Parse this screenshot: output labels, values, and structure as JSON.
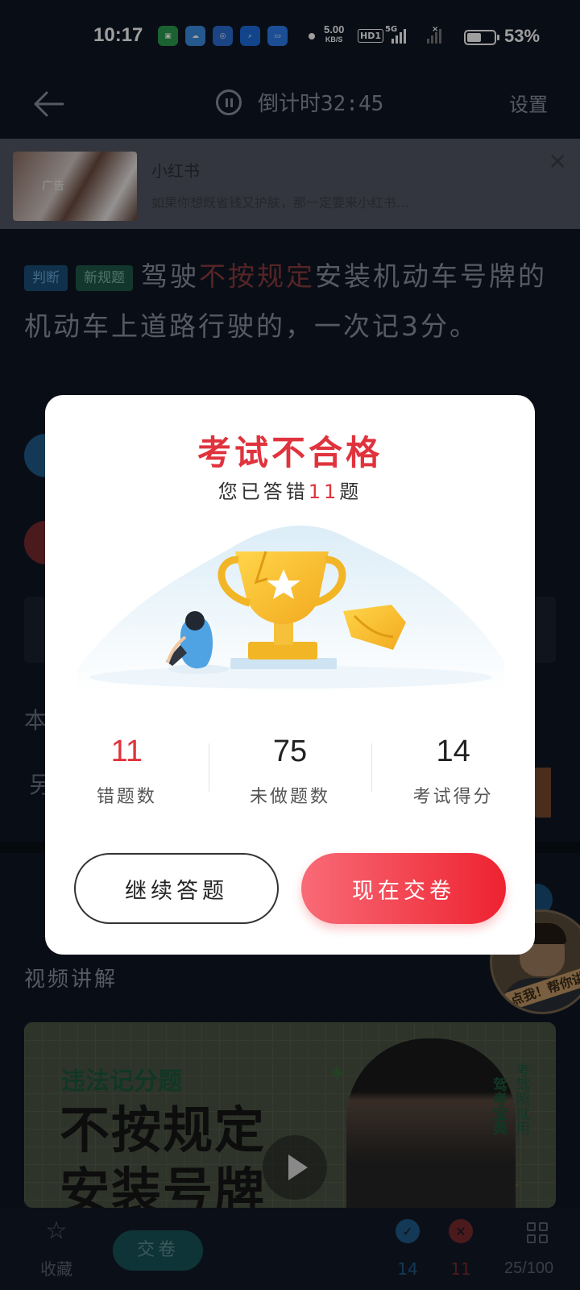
{
  "status_bar": {
    "time": "10:17",
    "net_speed_value": "5.00",
    "net_speed_unit": "KB/S",
    "hd_label": "HD1",
    "network_label": "5G",
    "battery_percent": "53%",
    "battery_level": 0.53,
    "apps": [
      "oppo-app-icon",
      "weather-app-icon",
      "browser-app-icon",
      "search-app-icon",
      "files-app-icon"
    ]
  },
  "header": {
    "back_icon": "arrow-left-icon",
    "countdown": "倒计时32:45",
    "settings_label": "设置"
  },
  "ad": {
    "badge": "广告",
    "title": "小红书",
    "description": "如果你想既省钱又护肤，那一定要来小红书…",
    "close_symbol": "✕"
  },
  "question": {
    "tags": [
      "判断",
      "新规题"
    ],
    "text_before": "驾驶",
    "text_highlight": "不按规定",
    "text_after": "安装机动车号牌的机动车上道路行驶的，一次记3分。"
  },
  "video": {
    "section_label": "视频讲解",
    "subtitle": "违法记分题",
    "headline_line1": "不按规定",
    "headline_line2": "安装号牌",
    "brand": "驾考宝典",
    "slogan": "考驾照就用"
  },
  "assistant": {
    "label": "点我！帮你讲"
  },
  "bottom_bar": {
    "favorite_label": "收藏",
    "submit_label": "交卷",
    "correct_count": "14",
    "wrong_count": "11",
    "progress": "25/100"
  },
  "dialog": {
    "title": "考试不合格",
    "subtitle_prefix": "您已答错",
    "subtitle_count": "11",
    "subtitle_suffix": "题",
    "stats": [
      {
        "value": "11",
        "label": "错题数"
      },
      {
        "value": "75",
        "label": "未做题数"
      },
      {
        "value": "14",
        "label": "考试得分"
      }
    ],
    "continue_button": "继续答题",
    "submit_button": "现在交卷"
  },
  "colors": {
    "accent_red": "#e0333d",
    "submit_gradient_start": "#f86b77",
    "submit_gradient_end": "#ee2230",
    "correct_blue": "#2b8ef0",
    "wrong_red": "#e24a4a"
  }
}
